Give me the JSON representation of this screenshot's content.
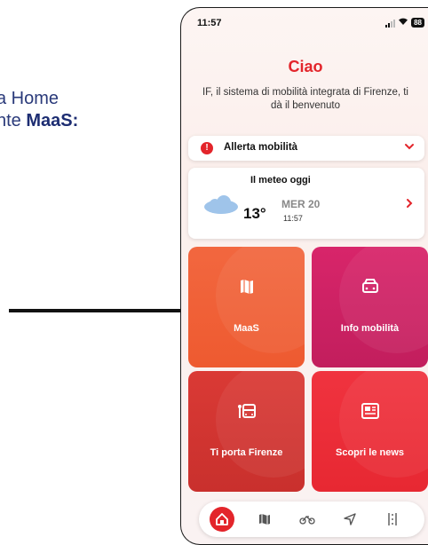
{
  "side_note": {
    "line1": "a Home",
    "line2_prefix": "nte ",
    "line2_bold": "MaaS:"
  },
  "status_bar": {
    "time": "11:57",
    "battery": "88"
  },
  "header": {
    "greeting": "Ciao",
    "subtitle": "IF, il sistema di mobilità integrata di Firenze, ti dà il benvenuto"
  },
  "alert": {
    "label": "Allerta mobilità",
    "icon": "exclamation-icon"
  },
  "weather": {
    "title": "Il meteo oggi",
    "temperature": "13°",
    "day": "MER 20",
    "time": "11:57",
    "icon": "cloud-icon"
  },
  "tiles": [
    {
      "label": "MaaS",
      "icon": "map-icon",
      "color": "#f2673f"
    },
    {
      "label": "Info mobilità",
      "icon": "car-icon",
      "color": "#d8256a"
    },
    {
      "label": "Ti porta Firenze",
      "icon": "bus-stop-icon",
      "color": "#da3a35"
    },
    {
      "label": "Scopri le news",
      "icon": "newspaper-icon",
      "color": "#f0333f"
    }
  ],
  "nav": [
    {
      "name": "home",
      "icon": "home-icon",
      "active": true
    },
    {
      "name": "map",
      "icon": "map-icon"
    },
    {
      "name": "bike",
      "icon": "bike-icon"
    },
    {
      "name": "navigate",
      "icon": "location-arrow-icon"
    },
    {
      "name": "services",
      "icon": "road-sign-icon"
    }
  ],
  "colors": {
    "brand_red": "#e3252b",
    "text_dark": "#111111"
  }
}
